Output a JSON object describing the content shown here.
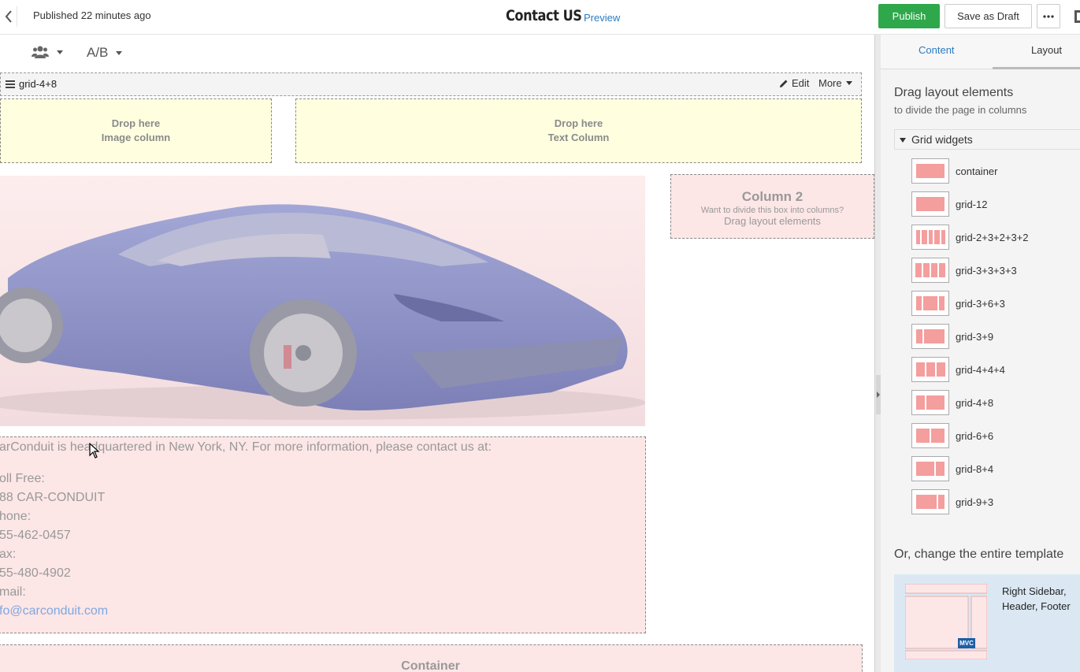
{
  "header": {
    "status": "Published 22 minutes ago",
    "title": "Contact US",
    "preview": "Preview",
    "publish": "Publish",
    "save_draft": "Save as Draft",
    "more": "•••"
  },
  "toolbar": {
    "ab": "A/B"
  },
  "grid_bar": {
    "name": "grid-4+8",
    "edit": "Edit",
    "more": "More"
  },
  "drops": [
    {
      "line1": "Drop here",
      "line2": "Image column"
    },
    {
      "line1": "Drop here",
      "line2": "Text Column"
    }
  ],
  "column2": {
    "title": "Column 2",
    "subtitle": "Want to divide this box into columns?",
    "hint": "Drag layout elements"
  },
  "info": {
    "intro": "arConduit is headquartered in New York, NY. For more information, please contact us at:",
    "lines": [
      "oll Free:",
      "88 CAR-CONDUIT",
      "hone:",
      "55-462-0457",
      "ax:",
      "55-480-4902",
      "mail:"
    ],
    "email": "fo@carconduit.com"
  },
  "container_label": "Container",
  "panel": {
    "tab_content": "Content",
    "tab_layout": "Layout",
    "heading": "Drag layout elements",
    "subheading": "to divide the page in columns",
    "section": "Grid widgets",
    "widgets": [
      "container",
      "grid-12",
      "grid-2+3+2+3+2",
      "grid-3+3+3+3",
      "grid-3+6+3",
      "grid-3+9",
      "grid-4+4+4",
      "grid-4+8",
      "grid-6+6",
      "grid-8+4",
      "grid-9+3"
    ],
    "template_heading": "Or, change the entire template",
    "template_label": "Right Sidebar, Header, Footer",
    "template_badge": "MVC"
  },
  "colors": {
    "accent": "#2b7bc4",
    "publish": "#2ea84a",
    "widget": "#f49e9e"
  }
}
